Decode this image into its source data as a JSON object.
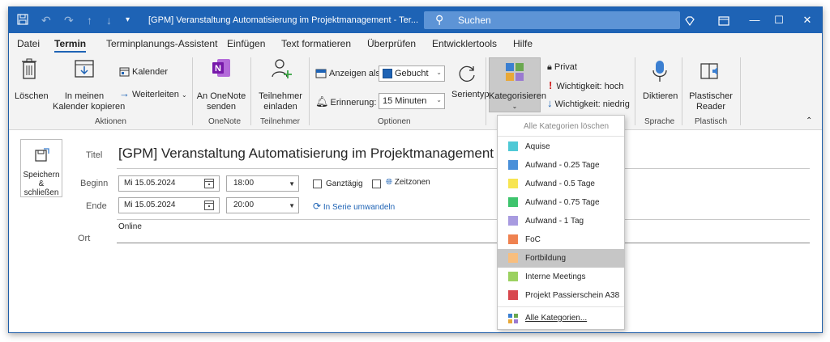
{
  "titlebar": {
    "title": "[GPM] Veranstaltung Automatisierung im Projektmanagement - Ter...",
    "search_label": "Suchen"
  },
  "menu": {
    "tabs": [
      {
        "label": "Datei"
      },
      {
        "label": "Termin"
      },
      {
        "label": "Terminplanungs-Assistent"
      },
      {
        "label": "Einfügen"
      },
      {
        "label": "Text formatieren"
      },
      {
        "label": "Überprüfen"
      },
      {
        "label": "Entwicklertools"
      },
      {
        "label": "Hilfe"
      }
    ],
    "active": "Termin"
  },
  "ribbon": {
    "aktionen": {
      "delete": "Löschen",
      "copy_line1": "In meinen",
      "copy_line2": "Kalender kopieren",
      "calendar": "Kalender",
      "forward": "Weiterleiten",
      "group": "Aktionen"
    },
    "onenote": {
      "line1": "An OneNote",
      "line2": "senden",
      "group": "OneNote"
    },
    "teilnehmer": {
      "line1": "Teilnehmer",
      "line2": "einladen",
      "group": "Teilnehmer"
    },
    "optionen": {
      "show_as_label": "Anzeigen als:",
      "show_as_value": "Gebucht",
      "reminder_label": "Erinnerung:",
      "reminder_value": "15 Minuten",
      "recurrence": "Serientyp",
      "group": "Optionen"
    },
    "kategorien": {
      "categorize": "Kategorisieren",
      "private": "Privat",
      "importance_high": "Wichtigkeit: hoch",
      "importance_low": "Wichtigkeit: niedrig"
    },
    "sprache": {
      "dictate": "Diktieren",
      "group": "Sprache"
    },
    "plastisch": {
      "line1": "Plastischer",
      "line2": "Reader",
      "group": "Plastisch"
    }
  },
  "form": {
    "save_line1": "Speichern",
    "save_line2": "&",
    "save_line3": "schließen",
    "title_label": "Titel",
    "title_value": "[GPM] Veranstaltung Automatisierung im Projektmanagement",
    "start_label": "Beginn",
    "start_date": "Mi 15.05.2024",
    "start_time": "18:00",
    "end_label": "Ende",
    "end_date": "Mi 15.05.2024",
    "end_time": "20:00",
    "all_day": "Ganztägig",
    "time_zones": "Zeitzonen",
    "make_recurring": "In Serie umwandeln",
    "location_label": "Ort",
    "location_value": "Online"
  },
  "category_menu": {
    "clear_all": "Alle Kategorien löschen",
    "items": [
      {
        "label": "Aquise",
        "color": "#4fc9d6"
      },
      {
        "label": "Aufwand - 0.25 Tage",
        "color": "#4a90d9"
      },
      {
        "label": "Aufwand - 0.5 Tage",
        "color": "#f7e552"
      },
      {
        "label": "Aufwand - 0.75 Tage",
        "color": "#3ec46d"
      },
      {
        "label": "Aufwand - 1 Tag",
        "color": "#a89be0"
      },
      {
        "label": "FoC",
        "color": "#ef8250"
      },
      {
        "label": "Fortbildung",
        "color": "#f8be7e"
      },
      {
        "label": "Interne Meetings",
        "color": "#9bd160"
      },
      {
        "label": "Projekt Passierschein A38",
        "color": "#d8484e"
      }
    ],
    "highlighted": "Fortbildung",
    "all_categories": "Alle Kategorien..."
  }
}
